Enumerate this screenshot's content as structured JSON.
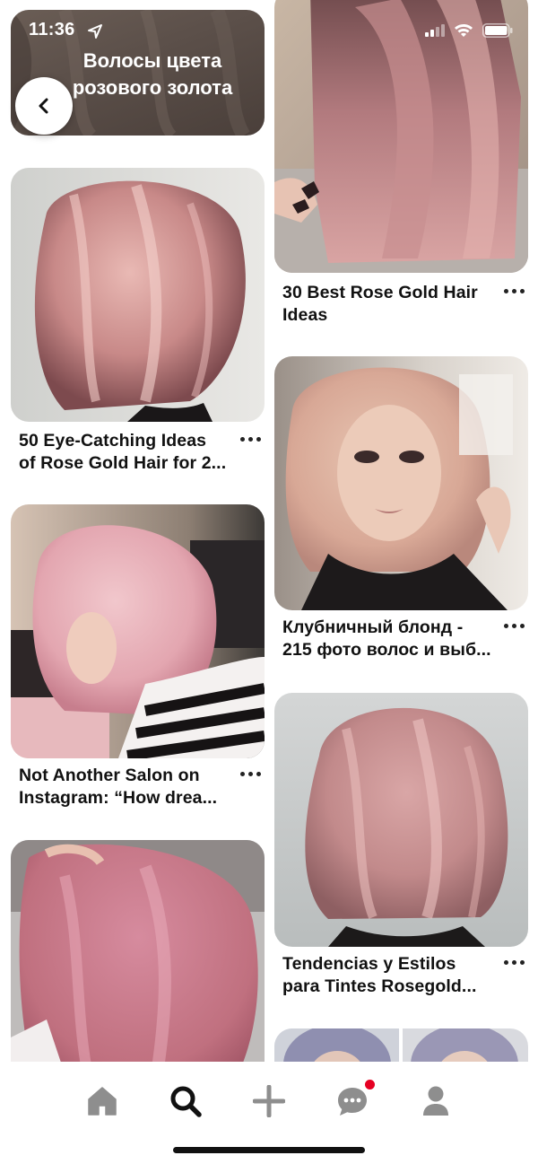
{
  "status_bar": {
    "time": "11:36"
  },
  "board": {
    "title": "Волосы цвета\nрозового золота"
  },
  "pins": {
    "left": [
      {
        "title": "50 Eye-Catching Ideas\nof Rose Gold Hair for 2..."
      },
      {
        "title": "Not Another Salon on\nInstagram: “How drea..."
      },
      {
        "title": ""
      }
    ],
    "right": [
      {
        "title": "30 Best Rose Gold Hair\nIdeas"
      },
      {
        "title": "Клубничный блонд -\n215 фото волос и выб..."
      },
      {
        "title": "Tendencias y Estilos\npara Tintes Rosegold..."
      },
      {
        "title": ""
      }
    ]
  },
  "nav": {
    "items": [
      "home-icon",
      "search-icon",
      "add-icon",
      "messages-icon",
      "profile-icon"
    ],
    "active": "search-icon",
    "notification_color": "#e60023"
  },
  "colors": {
    "accent": "#e60023",
    "icon_inactive": "#8e8e8e",
    "icon_active": "#111111"
  }
}
